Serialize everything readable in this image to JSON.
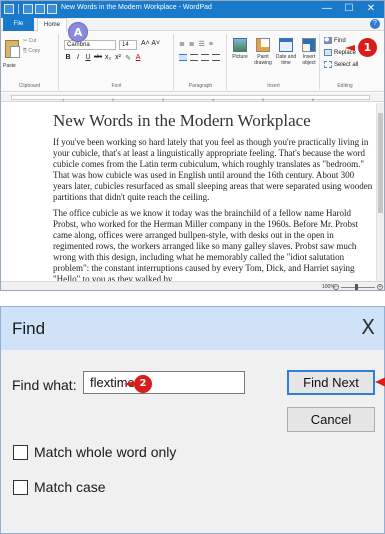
{
  "wordpad": {
    "title": "New Words in the Modern Workplace - WordPad",
    "window_controls": [
      "—",
      "☐",
      "✕"
    ],
    "tabs": {
      "file": "File",
      "home": "Home"
    },
    "help": "?",
    "ribbon": {
      "clipboard": {
        "paste": "Paste",
        "cut": "Cut",
        "copy": "Copy",
        "label": "Clipboard"
      },
      "font": {
        "family": "Cambria",
        "size": "14",
        "grow": "A˄ A˅",
        "label": "Font",
        "buttons": [
          "B",
          "I",
          "U",
          "abc",
          "x₂",
          "x²",
          "✎",
          "A"
        ]
      },
      "paragraph": {
        "label": "Paragraph",
        "top_buttons": "≣ ≣ ☰ ≡"
      },
      "insert": {
        "label": "Insert",
        "picture": "Picture",
        "paint": "Paint drawing",
        "datetime": "Date and time",
        "object": "Insert object"
      },
      "editing": {
        "label": "Editing",
        "find": "Find",
        "replace": "Replace",
        "select_all": "Select all"
      }
    },
    "ruler_ticks": [
      "1",
      "2",
      "3",
      "4",
      "5",
      "6"
    ],
    "document": {
      "heading": "New Words in the Modern Workplace",
      "p1": "If you've been working so hard lately that you feel as though you're practically living in your cubicle, that's at least a linguistically appropriate feeling. That's because the word cubicle comes from the Latin term cubiculum, which roughly translates as \"bedroom.\" That was how cubicle was used in English until around the 16th century. About 300 years later, cubicles resurfaced as small sleeping areas that were separated using wooden partitions that didn't quite reach the ceiling.",
      "p2": "The office cubicle as we know it today was the brainchild of a fellow name Harold Probst, who worked for the Herman Miller company in the 1960s. Before Mr. Probst came along, offices were arranged bullpen-style, with desks out in the open in regimented rows, the workers arranged like so many galley slaves. Probst saw much wrong with this design, including what he memorably called the \"idiot salutation problem\": the constant interruptions caused by every Tom, Dick, and Harriet saying \"Hello\" to you as they walked by."
    },
    "zoom": "100%"
  },
  "find_dialog": {
    "title": "Find",
    "close": "X",
    "find_what_label": "Find what:",
    "find_what_value": "flextime",
    "find_next": "Find Next",
    "cancel": "Cancel",
    "match_whole_word": "Match whole word only",
    "match_case": "Match case"
  },
  "callouts": {
    "a": "A",
    "one": "1",
    "two": "2"
  },
  "colors": {
    "accent": "#1979ca",
    "callout": "#d91c1c",
    "dialog_title": "#cfe2f7"
  }
}
